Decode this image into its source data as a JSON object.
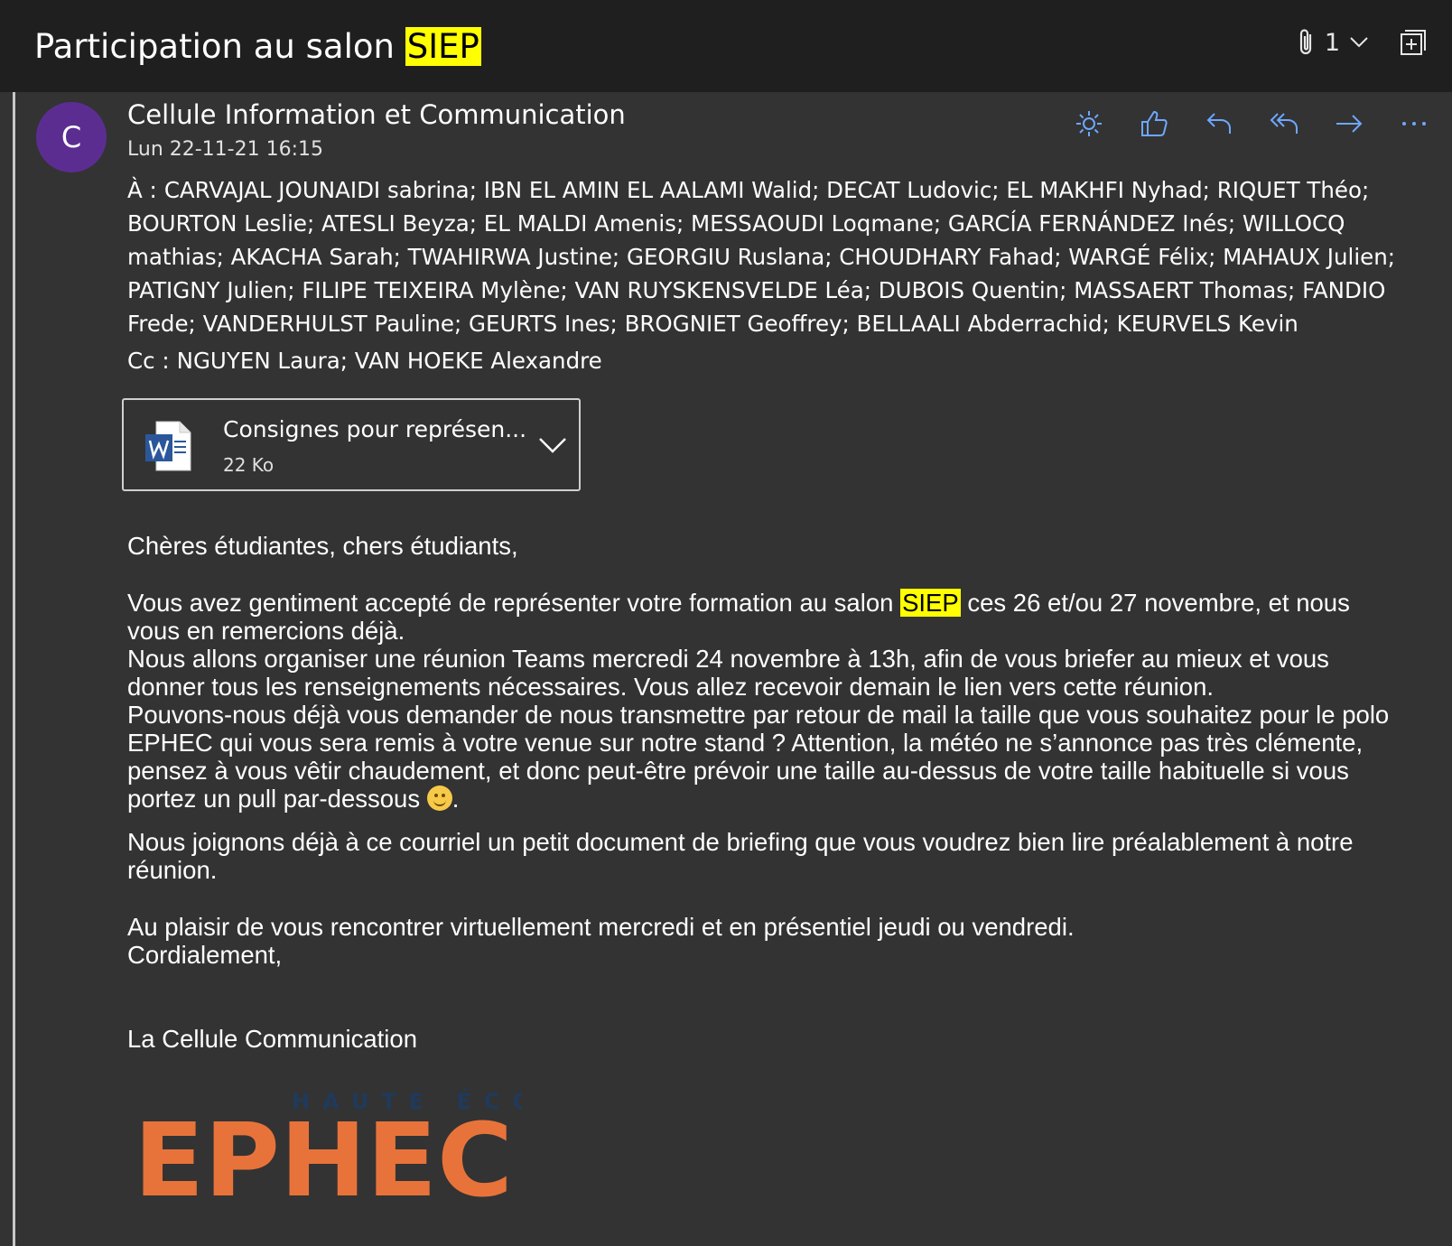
{
  "subject": {
    "prefix": "Participation au salon ",
    "highlight": "SIEP"
  },
  "header_icons": {
    "attachment_count": "1",
    "paperclip": "paperclip-icon",
    "expand": "expand-icon"
  },
  "sender": {
    "avatar_letter": "C",
    "name": "Cellule Information et Communication",
    "date": "Lun 22-11-21 16:15",
    "avatar_color": "#5c2d91"
  },
  "actions": [
    {
      "name": "sun-icon"
    },
    {
      "name": "like-icon"
    },
    {
      "name": "reply-icon"
    },
    {
      "name": "reply-all-icon"
    },
    {
      "name": "forward-icon"
    },
    {
      "name": "more-icon"
    }
  ],
  "to": {
    "label": "À :",
    "value": "CARVAJAL JOUNAIDI sabrina; IBN EL AMIN EL AALAMI Walid; DECAT Ludovic; EL MAKHFI Nyhad; RIQUET Théo; BOURTON Leslie; ATESLI Beyza; EL MALDI Amenis; MESSAOUDI Loqmane; GARCÍA FERNÁNDEZ Inés; WILLOCQ mathias; AKACHA Sarah; TWAHIRWA Justine; GEORGIU Ruslana; CHOUDHARY Fahad; WARGÉ Félix; MAHAUX Julien; PATIGNY Julien; FILIPE TEIXEIRA Mylène; VAN RUYSKENSVELDE Léa; DUBOIS Quentin; MASSAERT Thomas; FANDIO Frede; VANDERHULST Pauline; GEURTS Ines; BROGNIET Geoffrey; BELLAALI Abderrachid; KEURVELS Kevin"
  },
  "cc": {
    "label": "Cc :",
    "value": "NGUYEN Laura; VAN HOEKE Alexandre"
  },
  "attachment": {
    "name": "Consignes pour représen...",
    "size": "22 Ko",
    "icon": "word-icon"
  },
  "body": {
    "greeting": "Chères étudiantes, chers étudiants,",
    "p1_before": "Vous avez gentiment accepté de représenter votre formation au salon ",
    "p1_highlight": "SIEP",
    "p1_after": " ces 26 et/ou 27 novembre, et nous vous en remercions déjà.",
    "p2": "Nous allons organiser une réunion Teams mercredi 24 novembre à 13h, afin de vous briefer au mieux et vous donner tous les renseignements nécessaires. Vous allez recevoir demain le lien vers cette réunion.",
    "p3": "Pouvons-nous déjà vous demander de nous transmettre par retour de mail la taille que vous souhaitez pour le polo EPHEC qui vous sera remis à votre venue sur notre stand ? Attention, la météo ne s’annonce pas très clémente, pensez à vous vêtir chaudement, et donc peut-être prévoir une taille au-dessus de votre taille habituelle si vous portez un pull par-dessous",
    "p3_end": ".",
    "p4": "Nous joignons déjà à ce courriel un petit document de briefing que vous voudrez bien lire préalablement à notre réunion.",
    "closing1": "Au plaisir de vous rencontrer virtuellement mercredi et en présentiel jeudi ou vendredi.",
    "closing2": "Cordialement,",
    "signature": "La Cellule Communication"
  },
  "logo": {
    "top_text": "HAUTE ÉCOLE",
    "main_text": "EPHEC",
    "accent": "#e8733a",
    "top_color": "#1f3a5c"
  },
  "colors": {
    "highlight": "#ffff00",
    "action_blue": "#6ea8ff",
    "titlebar": "#1f1f1f",
    "background": "#333333"
  }
}
